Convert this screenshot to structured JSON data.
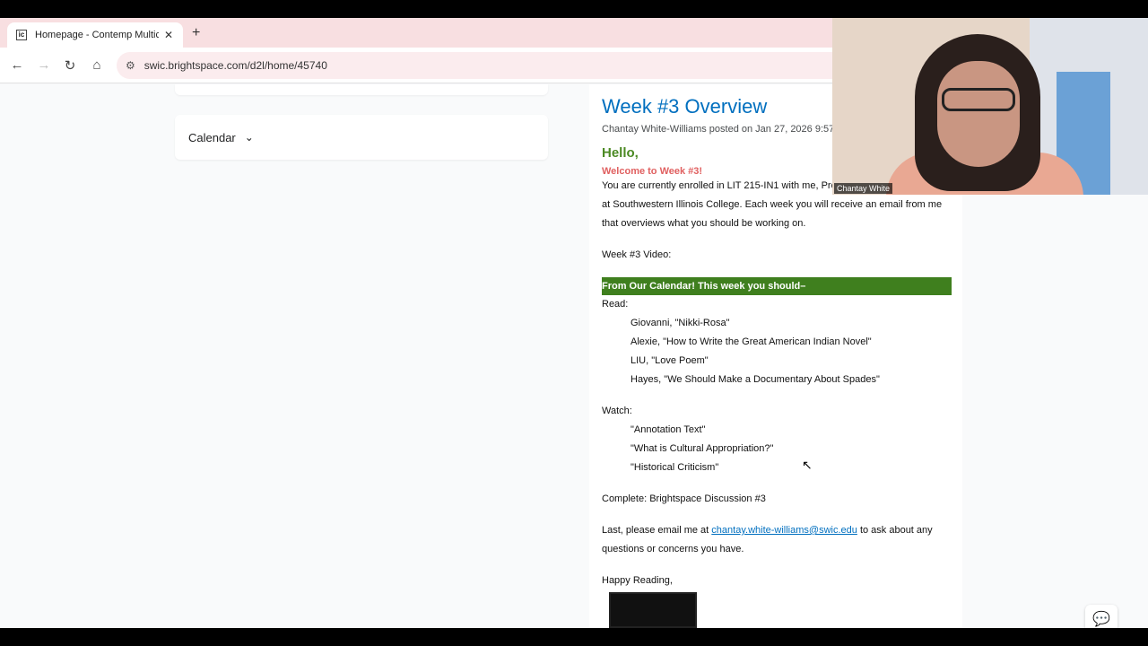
{
  "browser": {
    "tab_title": "Homepage - Contemp Multicul",
    "favicon_text": "ic",
    "url": "swic.brightspace.com/d2l/home/45740"
  },
  "sidebar": {
    "calendar_label": "Calendar"
  },
  "post": {
    "title": "Week #3 Overview",
    "posted_by": "Chantay White-Williams posted on Jan 27, 2026 9:57",
    "hello": "Hello,",
    "welcome": "Welcome to Week #3!",
    "intro": "You are currently enrolled in LIT 215-IN1 with me, Professor White—this spring at Southwestern Illinois College. Each week you will receive an email from me that overviews what you should be working on.",
    "video_label": "Week #3 Video:",
    "banner": "From Our Calendar! This week you should–",
    "read_label": "Read:",
    "read_items": [
      "Giovanni, \"Nikki-Rosa\"",
      "Alexie, \"How to Write the Great American Indian Novel\"",
      "LIU, \"Love Poem\"",
      "Hayes, \"We Should Make a Documentary About Spades\""
    ],
    "watch_label": "Watch:",
    "watch_items": [
      "\"Annotation Text\"",
      "\"What is Cultural Appropriation?\"",
      "\"Historical Criticism\""
    ],
    "complete": "Complete: Brightspace Discussion #3",
    "email_prefix": "Last, please email me at",
    "email": "chantay.white-williams@swic.edu",
    "email_suffix": "to ask about any questions or concerns you have.",
    "signoff": "Happy Reading,"
  },
  "video_overlay": {
    "name_label": "Chantay White"
  },
  "icons": {
    "back": "←",
    "forward": "→",
    "reload": "↻",
    "home": "⌂",
    "site_info": "⚙",
    "close": "✕",
    "new_tab": "+",
    "chevron": "⌄",
    "cursor": "↖",
    "chat": "💬",
    "scroll_down": "▼"
  }
}
